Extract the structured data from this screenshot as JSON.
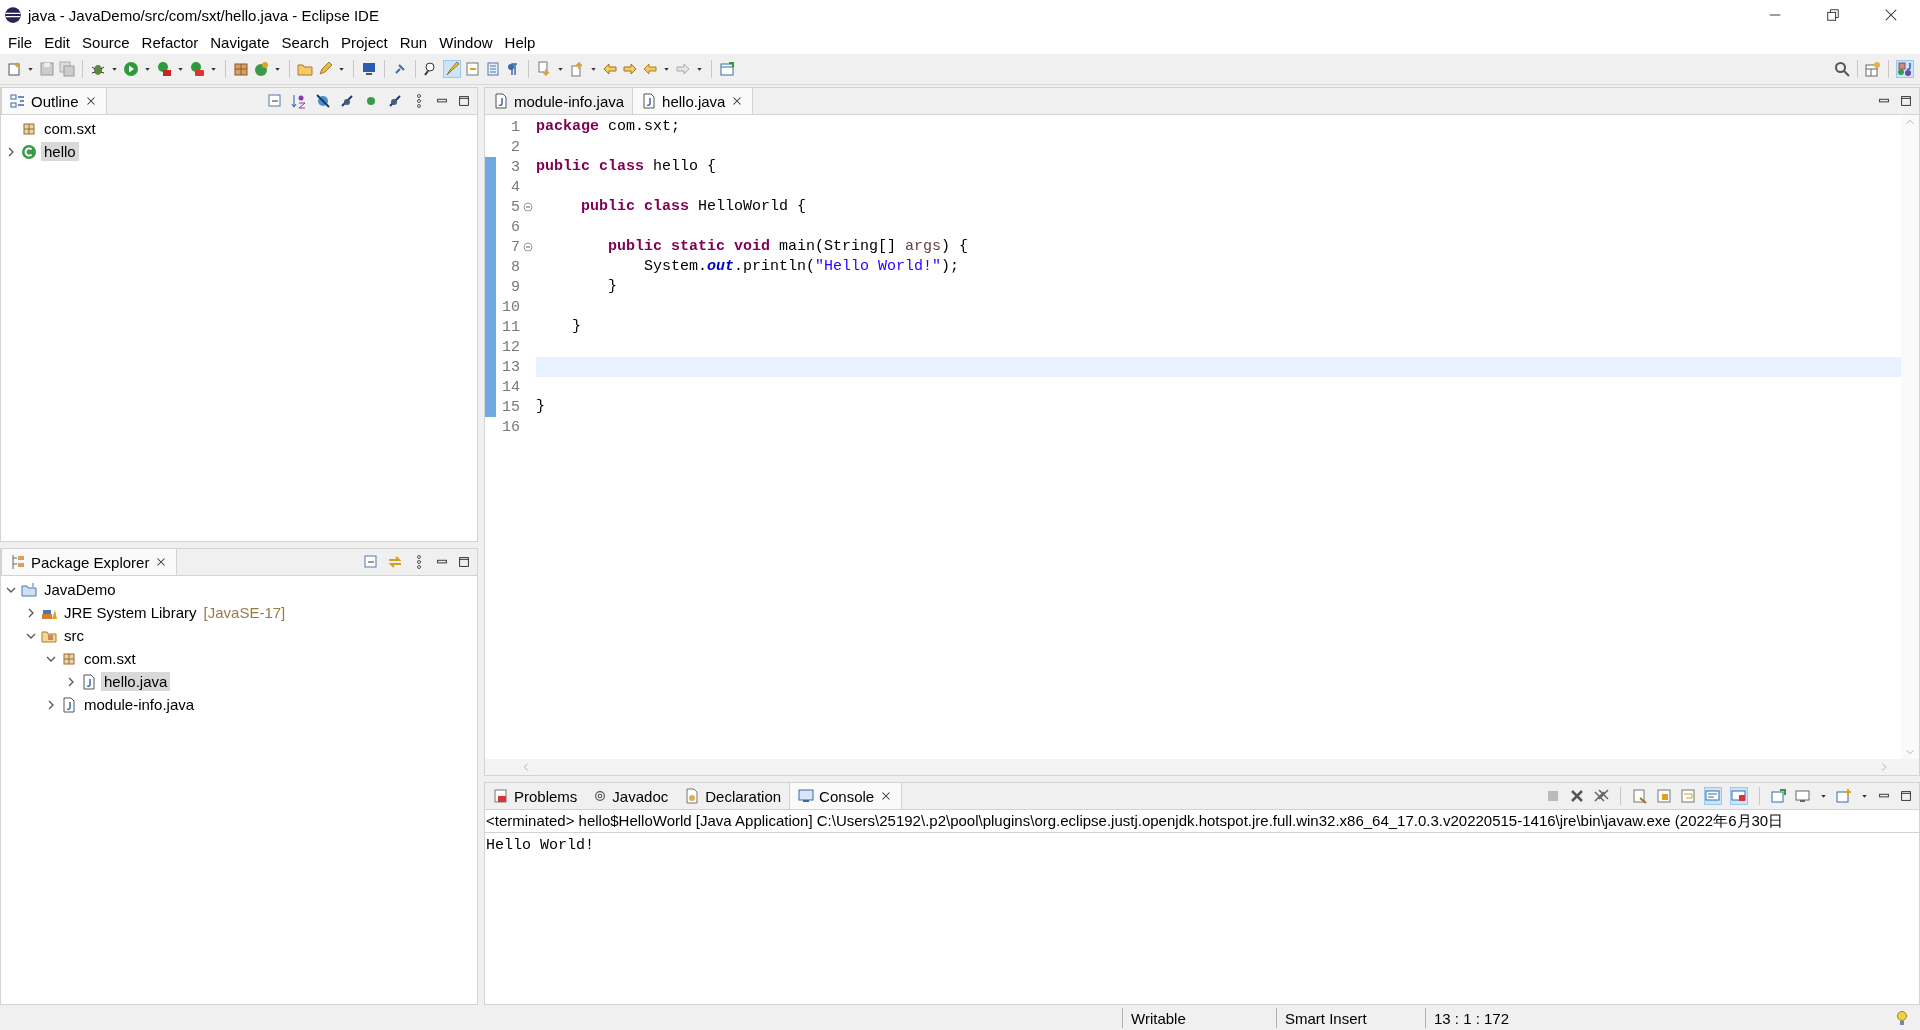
{
  "window": {
    "title": "java - JavaDemo/src/com/sxt/hello.java - Eclipse IDE"
  },
  "menu": [
    "File",
    "Edit",
    "Source",
    "Refactor",
    "Navigate",
    "Search",
    "Project",
    "Run",
    "Window",
    "Help"
  ],
  "outline": {
    "tab": {
      "label": "Outline",
      "selected": true
    },
    "items": [
      {
        "label": "com.sxt",
        "kind": "package",
        "selected": false
      },
      {
        "label": "hello",
        "kind": "class",
        "expanded": false,
        "selected": true
      }
    ]
  },
  "package_explorer": {
    "tab": {
      "label": "Package Explorer",
      "selected": true
    },
    "items": [
      {
        "label": "JavaDemo",
        "kind": "project",
        "expanded": true,
        "selected": false,
        "children": [
          {
            "label": "JRE System Library",
            "decoration": "[JavaSE-17]",
            "kind": "library",
            "expanded": false,
            "selected": false
          },
          {
            "label": "src",
            "kind": "source-folder",
            "expanded": true,
            "selected": false,
            "children": [
              {
                "label": "com.sxt",
                "kind": "package",
                "expanded": true,
                "selected": false,
                "children": [
                  {
                    "label": "hello.java",
                    "kind": "java-file",
                    "expanded": false,
                    "selected": true
                  }
                ]
              },
              {
                "label": "module-info.java",
                "kind": "java-file",
                "expanded": false,
                "selected": false
              }
            ]
          }
        ]
      }
    ]
  },
  "editor": {
    "tabs": [
      {
        "label": "module-info.java",
        "selected": false
      },
      {
        "label": "hello.java",
        "selected": true
      }
    ],
    "lines": [
      {
        "number": "1",
        "changed": false,
        "current": false,
        "tokens": [
          {
            "kind": "keyword",
            "text": "package"
          },
          {
            "kind": "text",
            "text": " com.sxt;"
          }
        ]
      },
      {
        "number": "2",
        "changed": false,
        "current": false
      },
      {
        "number": "3",
        "changed": true,
        "current": false,
        "tokens": [
          {
            "kind": "keyword",
            "text": "public class"
          },
          {
            "kind": "text",
            "text": " hello {"
          }
        ]
      },
      {
        "number": "4",
        "changed": true,
        "current": false
      },
      {
        "number": "5",
        "changed": true,
        "current": false,
        "expanded": true,
        "tokens": [
          {
            "kind": "keyword",
            "text": "     public class"
          },
          {
            "kind": "text",
            "text": " HelloWorld {"
          }
        ]
      },
      {
        "number": "6",
        "changed": true,
        "current": false
      },
      {
        "number": "7",
        "changed": true,
        "current": false,
        "expanded": true,
        "tokens": [
          {
            "kind": "keyword",
            "text": "        public static void"
          },
          {
            "kind": "text",
            "text": " main(String[] "
          },
          {
            "kind": "param",
            "text": "args"
          },
          {
            "kind": "text",
            "text": ") {"
          }
        ]
      },
      {
        "number": "8",
        "changed": true,
        "current": false,
        "tokens": [
          {
            "kind": "text",
            "text": "            System."
          },
          {
            "kind": "field",
            "text": "out"
          },
          {
            "kind": "text",
            "text": ".println("
          },
          {
            "kind": "string",
            "text": "\"Hello World!\""
          },
          {
            "kind": "text",
            "text": ");"
          }
        ]
      },
      {
        "number": "9",
        "changed": true,
        "current": false,
        "tokens": [
          {
            "kind": "text",
            "text": "        }"
          }
        ]
      },
      {
        "number": "10",
        "changed": true,
        "current": false
      },
      {
        "number": "11",
        "changed": true,
        "current": false,
        "tokens": [
          {
            "kind": "text",
            "text": "    }"
          }
        ]
      },
      {
        "number": "12",
        "changed": true,
        "current": false
      },
      {
        "number": "13",
        "changed": true,
        "current": true
      },
      {
        "number": "14",
        "changed": true,
        "current": false
      },
      {
        "number": "15",
        "changed": true,
        "current": false,
        "tokens": [
          {
            "kind": "text",
            "text": "}"
          }
        ]
      },
      {
        "number": "16",
        "changed": false,
        "current": false
      }
    ]
  },
  "console": {
    "tabs": [
      {
        "label": "Problems",
        "kind": "problems",
        "selected": false
      },
      {
        "label": "Javadoc",
        "kind": "javadoc",
        "selected": false
      },
      {
        "label": "Declaration",
        "kind": "declaration",
        "selected": false
      },
      {
        "label": "Console",
        "kind": "console",
        "selected": true
      }
    ],
    "header": "<terminated> hello$HelloWorld [Java Application] C:\\Users\\25192\\.p2\\pool\\plugins\\org.eclipse.justj.openjdk.hotspot.jre.full.win32.x86_64_17.0.3.v20220515-1416\\jre\\bin\\javaw.exe  (2022年6月30日",
    "output": [
      "Hello World!"
    ]
  },
  "status_bar": [
    "Writable",
    "Smart Insert",
    "13 : 1 : 172"
  ]
}
